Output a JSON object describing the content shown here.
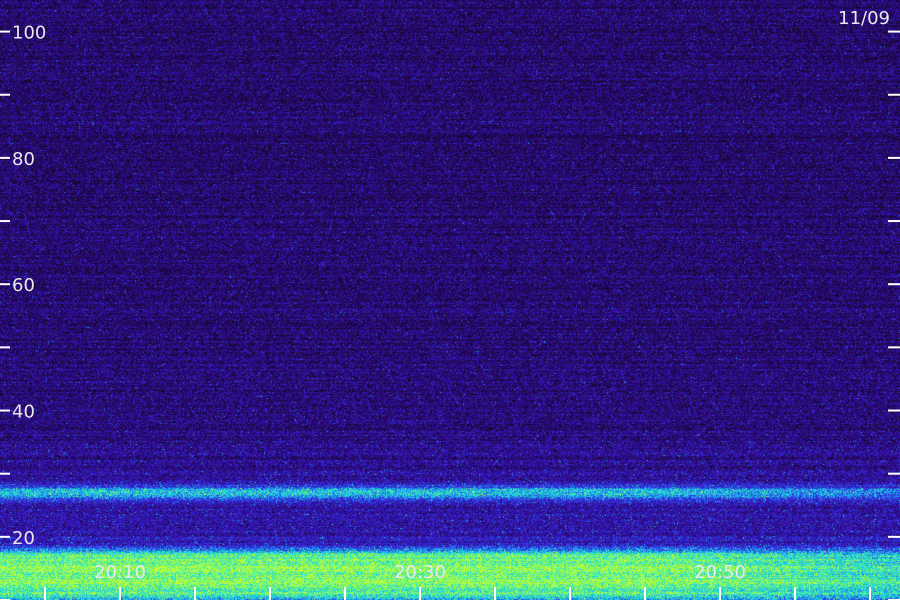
{
  "chart_data": {
    "type": "heatmap",
    "date_label": "11/09",
    "x_axis": {
      "range": [
        "20:02",
        "21:02"
      ],
      "labeled_ticks": [
        "20:10",
        "20:30",
        "20:50"
      ],
      "minor_ticks": [
        "20:05",
        "20:10",
        "20:15",
        "20:20",
        "20:25",
        "20:30",
        "20:35",
        "20:40",
        "20:45",
        "20:50",
        "20:55",
        "21:00"
      ]
    },
    "y_axis": {
      "range": [
        10,
        105
      ],
      "labeled_ticks": [
        20,
        40,
        60,
        80,
        100
      ],
      "minor_ticks": [
        10,
        30,
        50,
        70,
        90
      ]
    },
    "bands": [
      {
        "frequency": 27,
        "intensity": 0.85
      },
      {
        "frequency": 17,
        "intensity": 0.9
      },
      {
        "frequency": 15,
        "intensity": 0.95
      },
      {
        "frequency": 13,
        "intensity": 0.85
      },
      {
        "frequency": 11,
        "intensity": 0.7
      }
    ],
    "colormap": [
      "#17062e",
      "#2a0a7a",
      "#3a18c8",
      "#2a4ae8",
      "#18c8f0",
      "#40f0a0",
      "#c8ff30"
    ],
    "grid": false
  }
}
